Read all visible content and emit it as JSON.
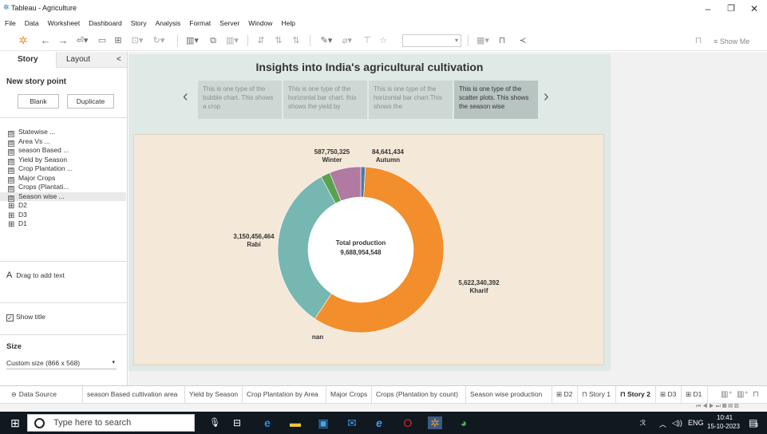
{
  "window": {
    "title": "Tableau - Agriculture"
  },
  "menu": [
    "File",
    "Data",
    "Worksheet",
    "Dashboard",
    "Story",
    "Analysis",
    "Format",
    "Server",
    "Window",
    "Help"
  ],
  "toolbar": {
    "show_me": "Show Me"
  },
  "left_panel": {
    "tab_story": "Story",
    "tab_layout": "Layout",
    "collapse": "<",
    "new_story_point": "New story point",
    "blank_btn": "Blank",
    "duplicate_btn": "Duplicate",
    "sheets": [
      {
        "label": "Statewise ...",
        "icon": "sheet"
      },
      {
        "label": "Area Vs ...",
        "icon": "sheet"
      },
      {
        "label": "season Based ...",
        "icon": "sheet"
      },
      {
        "label": "Yield by Season",
        "icon": "sheet-used"
      },
      {
        "label": "Crop Plantation ...",
        "icon": "sheet-used"
      },
      {
        "label": "Major Crops",
        "icon": "sheet"
      },
      {
        "label": "Crops (Plantati...",
        "icon": "sheet-used"
      },
      {
        "label": "Season wise ...",
        "icon": "sheet-used"
      },
      {
        "label": "D2",
        "icon": "dashboard"
      },
      {
        "label": "D3",
        "icon": "dashboard"
      },
      {
        "label": "D1",
        "icon": "dashboard"
      }
    ],
    "drag_text": "Drag to add text",
    "show_title_label": "Show title",
    "size_label": "Size",
    "size_value": "Custom size (866 x 568)"
  },
  "story": {
    "title": "Insights into India's agricultural cultivation",
    "points": [
      {
        "text": "This is one type of the bubble chart. This shows a crop",
        "active": false
      },
      {
        "text": "This is  one type of the horizontal bar chart. this shows the yield by",
        "active": false
      },
      {
        "text": "This is one type of the horizontal bar chart.This shows the",
        "active": false
      },
      {
        "text": "This is  one type of the scatter plots. This shows the season wise",
        "active": true
      }
    ]
  },
  "chart_data": {
    "type": "pie",
    "subtype": "donut",
    "center_label": "Total production",
    "center_value": "9,688,954,548",
    "slices": [
      {
        "name": "Autumn",
        "value_label": "84,641,434",
        "value": 84641434,
        "color": "#4e79a7"
      },
      {
        "name": "Kharif",
        "value_label": "5,622,340,392",
        "value": 5622340392,
        "color": "#f28e2b"
      },
      {
        "name": "nan",
        "value_label": "",
        "value": 3150456464,
        "color": "#76b7b2"
      },
      {
        "name": "Rabi",
        "value_label": "3,150,456,464",
        "value": 174000000,
        "color": "#59a14f"
      },
      {
        "name": "Winter",
        "value_label": "587,750,325",
        "value": 587750325,
        "color": "#b07aa1"
      }
    ]
  },
  "tabs": {
    "data_source": "Data Source",
    "items": [
      {
        "label": "season Based cultivation area",
        "active": false
      },
      {
        "label": "Yield by Season",
        "active": false
      },
      {
        "label": "Crop Plantation by Area",
        "active": false
      },
      {
        "label": "Major Crops",
        "active": false
      },
      {
        "label": "Crops (Plantation by count)",
        "active": false
      },
      {
        "label": "Season wise production",
        "active": false
      },
      {
        "label": "D2",
        "active": false
      },
      {
        "label": "Story 1",
        "active": false
      },
      {
        "label": "Story 2",
        "active": true
      },
      {
        "label": "D3",
        "active": false
      },
      {
        "label": "D1",
        "active": false
      }
    ]
  },
  "taskbar": {
    "search_placeholder": "Type here to search",
    "lang": "ENG",
    "time": "10:41",
    "date": "15-10-2023",
    "notif_count": "3"
  }
}
